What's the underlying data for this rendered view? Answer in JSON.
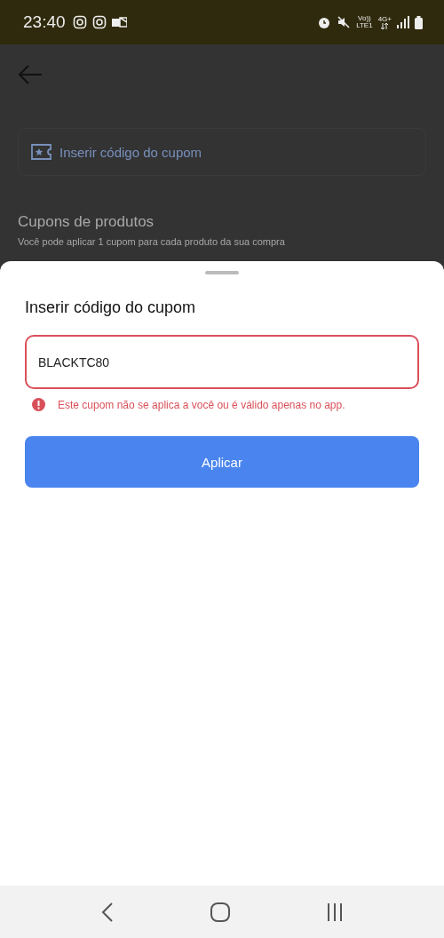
{
  "status_bar": {
    "time": "23:40",
    "network_labels": [
      "Vo))",
      "LTE1",
      "4G+"
    ]
  },
  "background_page": {
    "coupon_entry": {
      "label": "Inserir código do cupom"
    },
    "section_title": "Cupons de produtos",
    "section_subtitle": "Você pode aplicar 1 cupom para cada produto da sua compra"
  },
  "sheet": {
    "title": "Inserir código do cupom",
    "field": {
      "value": "BLACKTC80",
      "error": true
    },
    "error_message": "Este cupom não se aplica a você ou é válido apenas no app.",
    "button": "Aplicar"
  }
}
